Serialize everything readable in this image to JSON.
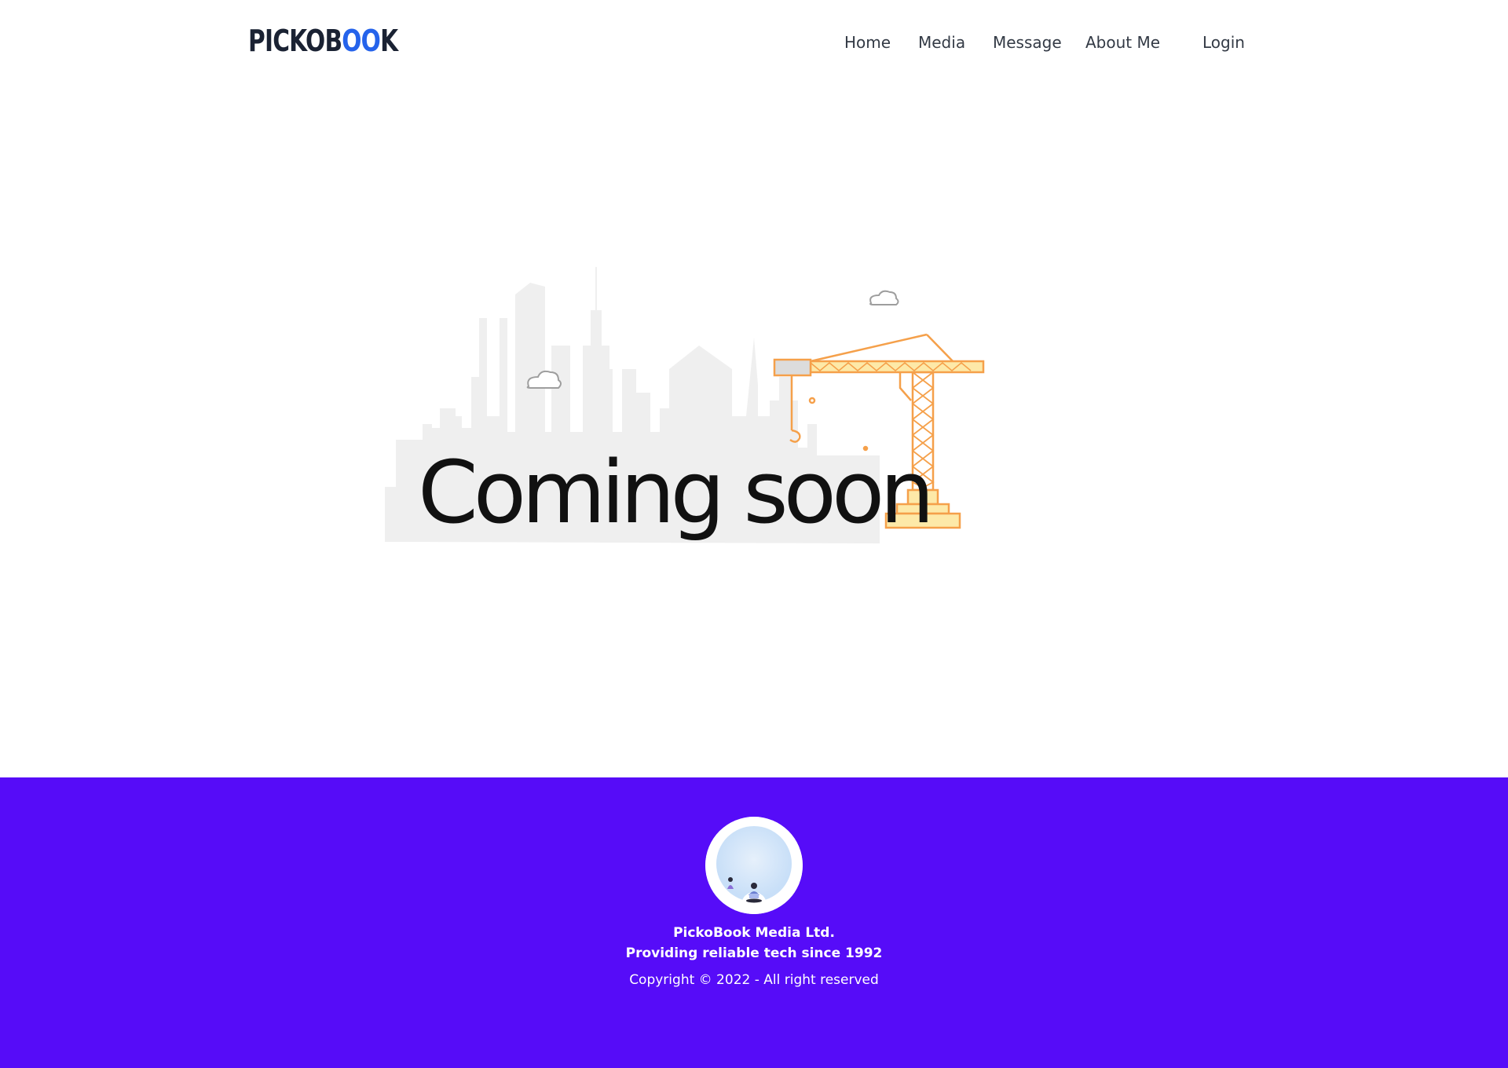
{
  "header": {
    "logo": {
      "part1": "PICKOB",
      "part2": "OO",
      "part3": "K"
    },
    "nav": [
      {
        "label": "Home"
      },
      {
        "label": "Media"
      },
      {
        "label": "Message"
      },
      {
        "label": "About Me"
      },
      {
        "label": "Login"
      }
    ]
  },
  "hero": {
    "heading": "Coming soon",
    "colors": {
      "skyline": "#efefef",
      "crane": "#f5a04a",
      "crane_base": "#fde9a8"
    }
  },
  "footer": {
    "company": "PickoBook Media Ltd.",
    "tagline": "Providing reliable tech since 1992",
    "copyright": "Copyright © 2022 - All right reserved",
    "background": "#560cf8"
  }
}
